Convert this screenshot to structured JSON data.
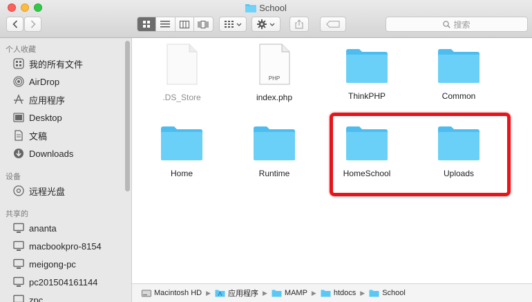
{
  "window": {
    "title": "School"
  },
  "toolbar": {
    "back_label": "<",
    "forward_label": ">",
    "search_placeholder": "搜索"
  },
  "sidebar": {
    "sections": [
      {
        "header": "个人收藏",
        "items": [
          {
            "label": "我的所有文件",
            "icon": "all-files-icon"
          },
          {
            "label": "AirDrop",
            "icon": "airdrop-icon"
          },
          {
            "label": "应用程序",
            "icon": "applications-icon"
          },
          {
            "label": "Desktop",
            "icon": "desktop-icon"
          },
          {
            "label": "文稿",
            "icon": "documents-icon"
          },
          {
            "label": "Downloads",
            "icon": "downloads-icon"
          }
        ]
      },
      {
        "header": "设备",
        "items": [
          {
            "label": "远程光盘",
            "icon": "disc-icon"
          }
        ]
      },
      {
        "header": "共享的",
        "items": [
          {
            "label": "ananta",
            "icon": "computer-icon"
          },
          {
            "label": "macbookpro-8154",
            "icon": "computer-icon"
          },
          {
            "label": "meigong-pc",
            "icon": "computer-icon"
          },
          {
            "label": "pc201504161144",
            "icon": "computer-icon"
          },
          {
            "label": "zpc",
            "icon": "computer-icon"
          }
        ]
      }
    ]
  },
  "files": [
    {
      "name": ".DS_Store",
      "kind": "document",
      "dim": true
    },
    {
      "name": "index.php",
      "kind": "php",
      "badge": "PHP"
    },
    {
      "name": "ThinkPHP",
      "kind": "folder"
    },
    {
      "name": "Common",
      "kind": "folder"
    },
    {
      "name": "Home",
      "kind": "folder"
    },
    {
      "name": "Runtime",
      "kind": "folder"
    },
    {
      "name": "HomeSchool",
      "kind": "folder"
    },
    {
      "name": "Uploads",
      "kind": "folder"
    }
  ],
  "pathbar": [
    {
      "label": "Macintosh HD",
      "icon": "hard-drive-icon"
    },
    {
      "label": "应用程序",
      "icon": "applications-folder-icon"
    },
    {
      "label": "MAMP",
      "icon": "folder-icon"
    },
    {
      "label": "htdocs",
      "icon": "folder-icon"
    },
    {
      "label": "School",
      "icon": "folder-icon"
    }
  ],
  "colors": {
    "folder": "#5ac8f5",
    "highlight": "#e8141b",
    "sidebar": "#e8e8e8"
  }
}
